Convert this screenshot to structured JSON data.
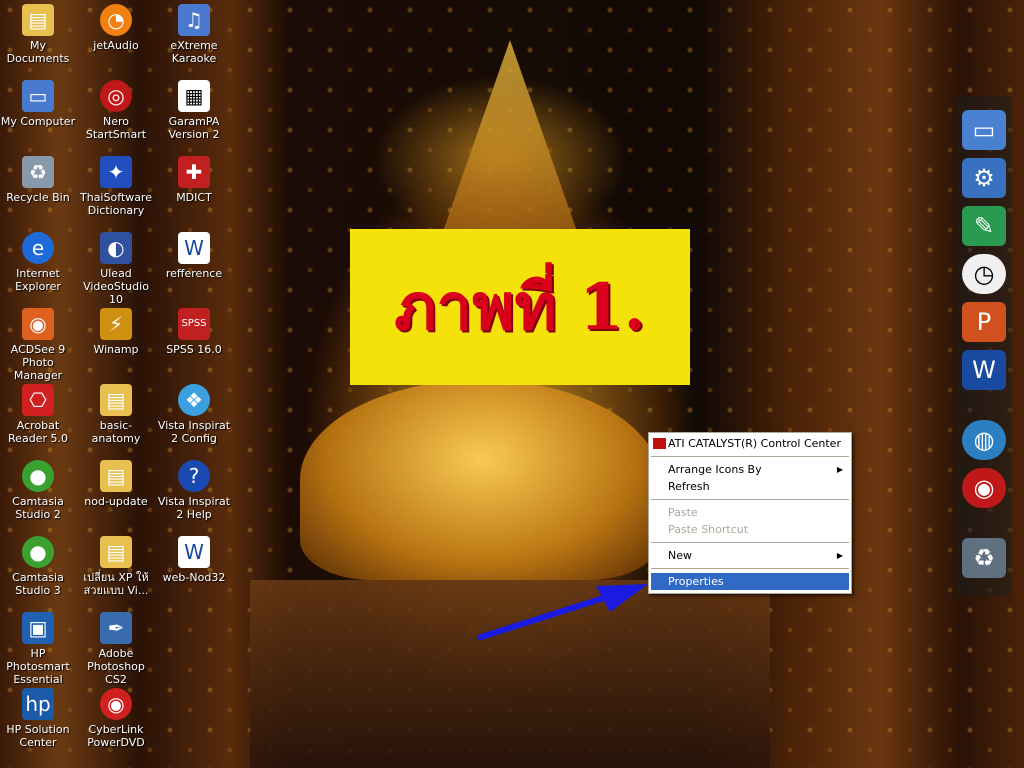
{
  "banner": {
    "text": "ภาพที่ 1."
  },
  "desktop_icons": [
    {
      "label": "My Documents",
      "icon": "folder-icon"
    },
    {
      "label": "jetAudio",
      "icon": "jetaudio-icon"
    },
    {
      "label": "eXtreme Karaoke",
      "icon": "karaoke-icon"
    },
    {
      "label": "My Computer",
      "icon": "computer-icon"
    },
    {
      "label": "Nero StartSmart",
      "icon": "nero-icon"
    },
    {
      "label": "GaramPA Version 2",
      "icon": "shortcut-icon"
    },
    {
      "label": "Recycle Bin",
      "icon": "trash-icon"
    },
    {
      "label": "ThaiSoftware Dictionary",
      "icon": "dictionary-icon"
    },
    {
      "label": "MDICT",
      "icon": "mdict-icon"
    },
    {
      "label": "Internet Explorer",
      "icon": "ie-icon"
    },
    {
      "label": "Ulead VideoStudio 10",
      "icon": "videostudio-icon"
    },
    {
      "label": "refference",
      "icon": "word-doc-icon"
    },
    {
      "label": "ACDSee 9 Photo Manager",
      "icon": "acdsee-icon"
    },
    {
      "label": "Winamp",
      "icon": "winamp-icon"
    },
    {
      "label": "SPSS 16.0",
      "icon": "spss-icon"
    },
    {
      "label": "Acrobat Reader 5.0",
      "icon": "acrobat-icon"
    },
    {
      "label": "basic-anatomy",
      "icon": "folder-icon"
    },
    {
      "label": "Vista Inspirat 2 Config",
      "icon": "vista-icon"
    },
    {
      "label": "Camtasia Studio 2",
      "icon": "camtasia-icon"
    },
    {
      "label": "nod-update",
      "icon": "folder-icon"
    },
    {
      "label": "Vista Inspirat 2 Help",
      "icon": "help-icon"
    },
    {
      "label": "Camtasia Studio 3",
      "icon": "camtasia-icon"
    },
    {
      "label": "เปลี่ยน XP ให้ สวยแบบ Vi...",
      "icon": "folder-icon"
    },
    {
      "label": "web-Nod32",
      "icon": "word-doc-icon"
    },
    {
      "label": "HP Photosmart Essential",
      "icon": "hp-photosmart-icon"
    },
    {
      "label": "Adobe Photoshop CS2",
      "icon": "photoshop-icon"
    },
    {
      "label": "HP Solution Center",
      "icon": "hp-icon"
    },
    {
      "label": "CyberLink PowerDVD",
      "icon": "powerdvd-icon"
    }
  ],
  "dock_items": [
    {
      "icon": "computer-icon"
    },
    {
      "icon": "control-panel-icon"
    },
    {
      "icon": "feather-icon"
    },
    {
      "icon": "clock-icon"
    },
    {
      "icon": "powerpoint-icon"
    },
    {
      "icon": "word-icon"
    },
    {
      "icon": "globe-icon"
    },
    {
      "icon": "dvd-icon"
    },
    {
      "icon": "recycle-bin-icon"
    }
  ],
  "context_menu": {
    "ati": "ATI CATALYST(R) Control Center",
    "arrange": "Arrange Icons By",
    "refresh": "Refresh",
    "paste": "Paste",
    "paste_shortcut": "Paste Shortcut",
    "new": "New",
    "properties": "Properties"
  },
  "colors": {
    "banner_bg": "#f4e20a",
    "banner_text": "#d8001a",
    "menu_highlight": "#316ac5",
    "arrow": "#1a1ae0"
  }
}
